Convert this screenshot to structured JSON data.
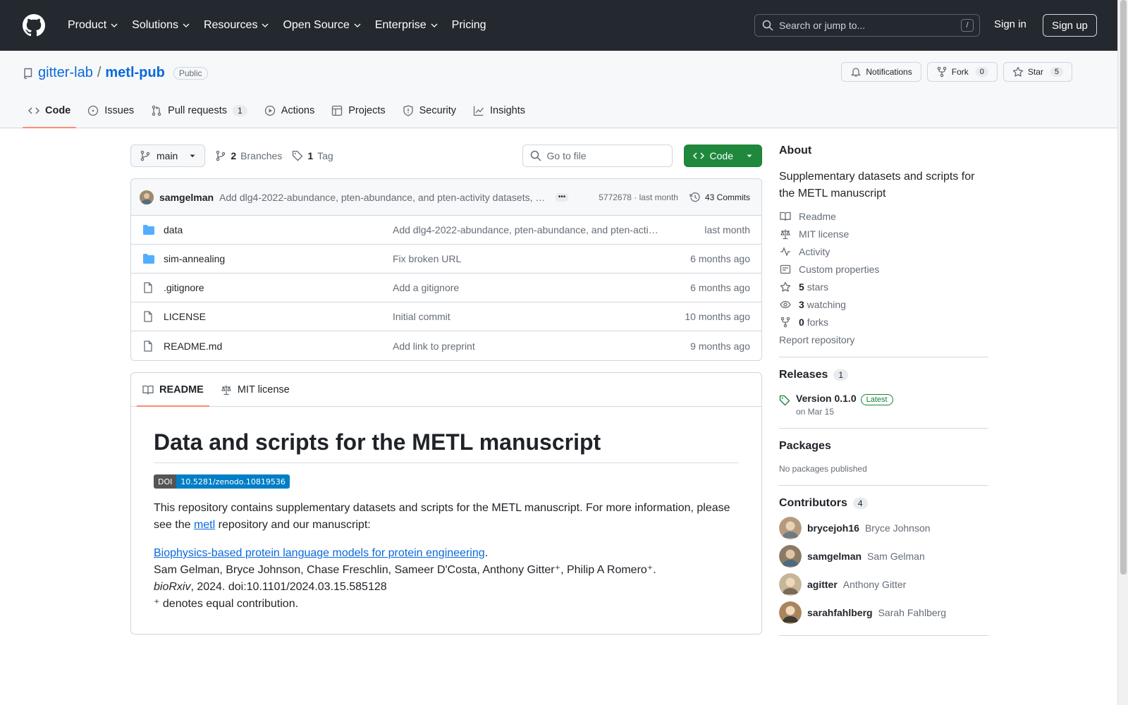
{
  "header": {
    "nav": [
      "Product",
      "Solutions",
      "Resources",
      "Open Source",
      "Enterprise",
      "Pricing"
    ],
    "search_placeholder": "Search or jump to...",
    "search_shortcut": "/",
    "signin": "Sign in",
    "signup": "Sign up"
  },
  "repo": {
    "owner": "gitter-lab",
    "separator": "/",
    "name": "metl-pub",
    "visibility": "Public",
    "notifications": "Notifications",
    "fork_label": "Fork",
    "fork_count": "0",
    "star_label": "Star",
    "star_count": "5"
  },
  "tabs": [
    {
      "label": "Code"
    },
    {
      "label": "Issues"
    },
    {
      "label": "Pull requests",
      "count": "1"
    },
    {
      "label": "Actions"
    },
    {
      "label": "Projects"
    },
    {
      "label": "Security"
    },
    {
      "label": "Insights"
    }
  ],
  "toolbar": {
    "branch": "main",
    "branches_count": "2",
    "branches_label": "Branches",
    "tags_count": "1",
    "tags_label": "Tag",
    "goto_placeholder": "Go to file",
    "code_button": "Code"
  },
  "commit": {
    "author": "samgelman",
    "message": "Add dlg4-2022-abundance, pten-abundance, and pten-activity datasets, …",
    "hash_time": "5772678 · last month",
    "commits_label": "43 Commits"
  },
  "files": [
    {
      "name": "data",
      "type": "dir",
      "message": "Add dlg4-2022-abundance, pten-abundance, and pten-activ…",
      "age": "last month"
    },
    {
      "name": "sim-annealing",
      "type": "dir",
      "message": "Fix broken URL",
      "age": "6 months ago"
    },
    {
      "name": ".gitignore",
      "type": "file",
      "message": "Add a gitignore",
      "age": "6 months ago"
    },
    {
      "name": "LICENSE",
      "type": "file",
      "message": "Initial commit",
      "age": "10 months ago"
    },
    {
      "name": "README.md",
      "type": "file",
      "message": "Add link to preprint",
      "age": "9 months ago"
    }
  ],
  "readme": {
    "tab_readme": "README",
    "tab_license": "MIT license",
    "title": "Data and scripts for the METL manuscript",
    "doi_label": "DOI",
    "doi_value": "10.5281/zenodo.10819536",
    "intro_1": "This repository contains supplementary datasets and scripts for the METL manuscript. For more information, please see the ",
    "intro_link": "metl",
    "intro_2": " repository and our manuscript:",
    "paper_link": "Biophysics-based protein language models for protein engineering",
    "paper_period": ".",
    "authors": "Sam Gelman, Bryce Johnson, Chase Freschlin, Sameer D'Costa, Anthony Gitter⁺, Philip A Romero⁺.",
    "journal": "bioRxiv",
    "citation_rest": ", 2024. doi:10.1101/2024.03.15.585128",
    "footnote": "⁺ denotes equal contribution."
  },
  "about": {
    "title": "About",
    "description": "Supplementary datasets and scripts for the METL manuscript",
    "readme": "Readme",
    "license": "MIT license",
    "activity": "Activity",
    "custom_properties": "Custom properties",
    "stars_count": "5",
    "stars_label": "stars",
    "watching_count": "3",
    "watching_label": "watching",
    "forks_count": "0",
    "forks_label": "forks",
    "report": "Report repository"
  },
  "releases": {
    "title": "Releases",
    "count": "1",
    "version": "Version 0.1.0",
    "latest": "Latest",
    "date": "on Mar 15"
  },
  "packages": {
    "title": "Packages",
    "empty": "No packages published"
  },
  "contributors": {
    "title": "Contributors",
    "count": "4",
    "list": [
      {
        "login": "brycejoh16",
        "name": "Bryce Johnson",
        "color": "#b59a7e"
      },
      {
        "login": "samgelman",
        "name": "Sam Gelman",
        "color": "#8a7a66"
      },
      {
        "login": "agitter",
        "name": "Anthony Gitter",
        "color": "#c7b59a"
      },
      {
        "login": "sarahfahlberg",
        "name": "Sarah Fahlberg",
        "color": "#a8855c"
      }
    ]
  },
  "colors": {
    "header_bg": "#24292f",
    "link": "#0969da",
    "code_button": "#1f883d",
    "active_tab": "#fd8c73",
    "folder": "#54aeff"
  }
}
